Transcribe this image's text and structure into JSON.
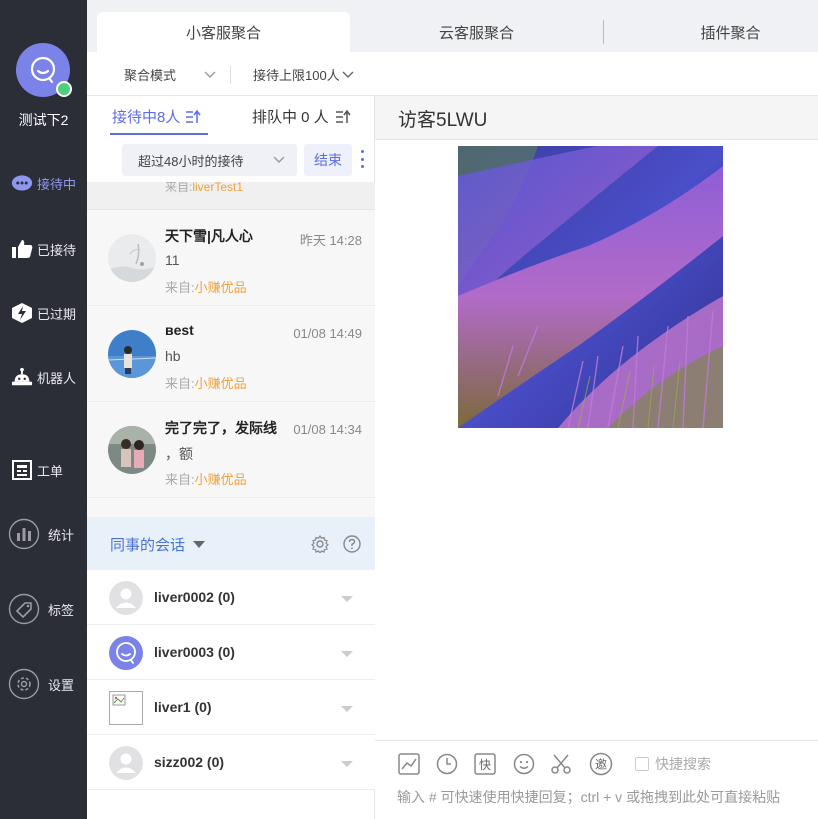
{
  "nav": {
    "username": "测试下2",
    "items": [
      {
        "label": "接待中",
        "icon": "chat-bubble-icon",
        "active": true
      },
      {
        "label": "已接待",
        "icon": "thumbs-up-icon",
        "active": false
      },
      {
        "label": "已过期",
        "icon": "expired-bolt-icon",
        "active": false
      },
      {
        "label": "机器人",
        "icon": "robot-icon",
        "active": false
      },
      {
        "label": "工单",
        "icon": "ticket-icon",
        "active": false
      },
      {
        "label": "统计",
        "icon": "stats-icon",
        "active": false
      },
      {
        "label": "标签",
        "icon": "tag-icon",
        "active": false
      },
      {
        "label": "设置",
        "icon": "settings-icon",
        "active": false
      }
    ]
  },
  "top_tabs": [
    {
      "label": "小客服聚合",
      "active": true
    },
    {
      "label": "云客服聚合",
      "active": false
    },
    {
      "label": "插件聚合",
      "active": false
    }
  ],
  "toolbar": {
    "mode_label": "聚合模式",
    "limit_label": "接待上限100人"
  },
  "queue": {
    "active_tab": "接待中8人",
    "waiting_tab": "排队中 0 人",
    "filter_value": "超过48小时的接待",
    "end_button": "结束"
  },
  "conversations": {
    "partial": {
      "source_prefix": "来自:",
      "source": "liverTest1"
    },
    "items": [
      {
        "name": "天下雪|凡人心",
        "time": "昨天 14:28",
        "message": "11",
        "source_prefix": "来自:",
        "source": "小赚优品"
      },
      {
        "name": "ʙest",
        "time": "01/08 14:49",
        "message": "hb",
        "source_prefix": "来自:",
        "source": "小赚优品"
      },
      {
        "name": "完了完了，发际线",
        "time": "01/08 14:34",
        "message": "，额",
        "source_prefix": "来自:",
        "source": "小赚优品"
      }
    ]
  },
  "colleagues": {
    "header": "同事的会话",
    "items": [
      {
        "name": "liver0002 (0)",
        "avatar": "default-avatar-icon"
      },
      {
        "name": "liver0003 (0)",
        "avatar": "bot-avatar-icon"
      },
      {
        "name": "liver1 (0)",
        "avatar": "broken-image-icon"
      },
      {
        "name": "sizz002 (0)",
        "avatar": "default-avatar-icon"
      }
    ]
  },
  "chat": {
    "title": "访客5LWU",
    "quick_search_label": "快捷搜索",
    "input_placeholder": "输入 # 可快速使用快捷回复；ctrl + v 或拖拽到此处可直接粘贴"
  },
  "colors": {
    "nav_bg": "#2b2d37",
    "accent": "#5c6ee6",
    "source_orange": "#f0a23d",
    "online_green": "#4cd07a"
  }
}
